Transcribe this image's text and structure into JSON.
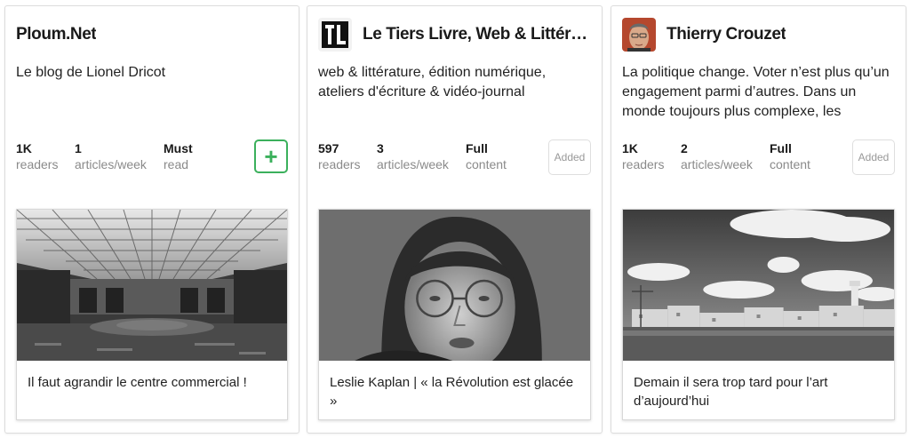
{
  "cards": [
    {
      "title": "Ploum.Net",
      "description": "Le blog de Lionel Dricot",
      "stats": [
        {
          "value": "1K",
          "label": "readers"
        },
        {
          "value": "1",
          "label": "articles/week"
        },
        {
          "value": "Must",
          "label": "read"
        }
      ],
      "follow_icon": "plus-icon",
      "article_title": "Il faut agrandir le centre commercial !"
    },
    {
      "title": "Le Tiers Livre, Web & Littéra…",
      "description": "web & littérature, édition numérique, ateliers d'écriture & vidéo-journal",
      "stats": [
        {
          "value": "597",
          "label": "readers"
        },
        {
          "value": "3",
          "label": "articles/week"
        },
        {
          "value": "Full",
          "label": "content"
        }
      ],
      "added_label": "Added",
      "article_title": "Leslie Kaplan | « la Révolution est glacée »"
    },
    {
      "title": "Thierry Crouzet",
      "description": "La politique change. Voter n’est plus qu’un engagement parmi d’autres. Dans un monde toujours plus complexe, les",
      "stats": [
        {
          "value": "1K",
          "label": "readers"
        },
        {
          "value": "2",
          "label": "articles/week"
        },
        {
          "value": "Full",
          "label": "content"
        }
      ],
      "added_label": "Added",
      "article_title": "Demain il sera trop tard pour l’art d’aujourd’hui"
    }
  ],
  "colors": {
    "follow_green": "#3bb05c",
    "label_gray": "#8a8a8a",
    "border": "#dcdcdc"
  }
}
